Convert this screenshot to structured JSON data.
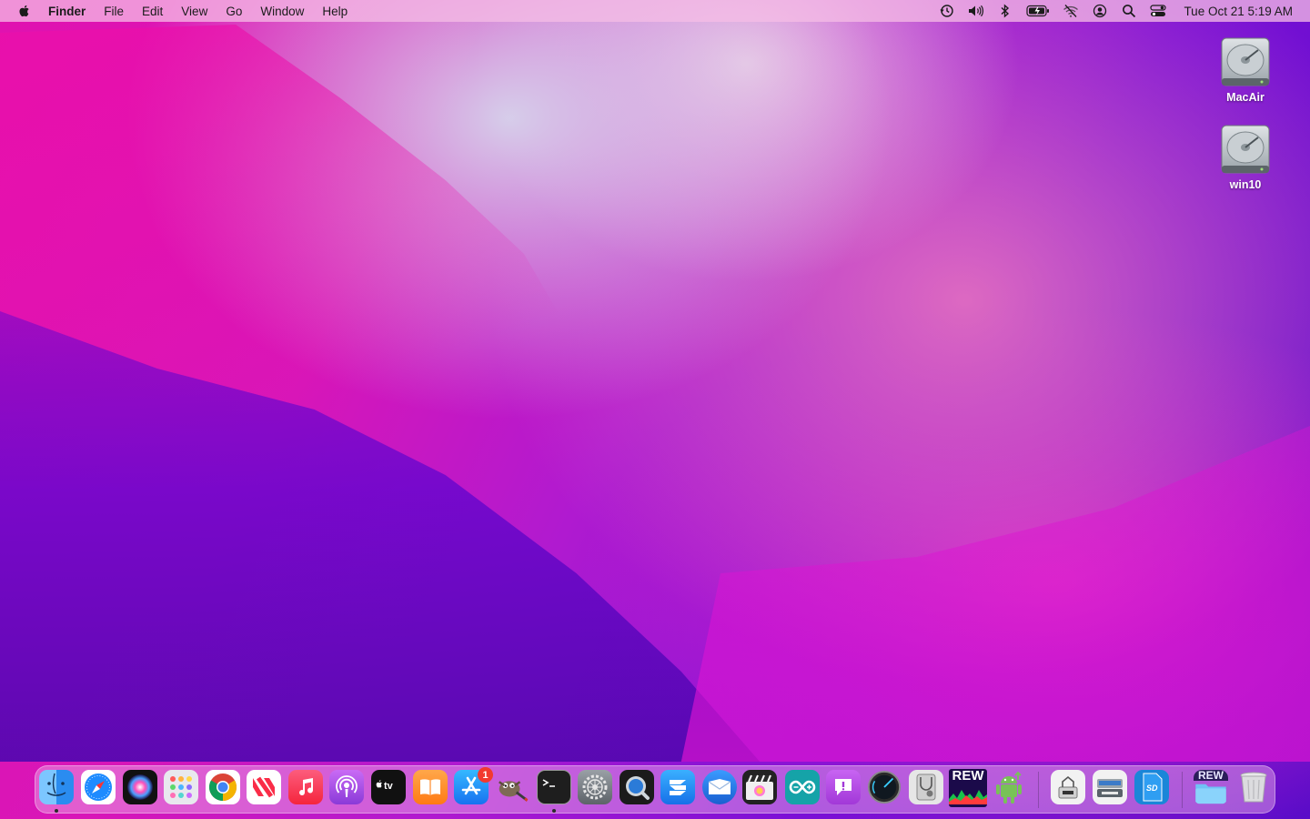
{
  "menubar": {
    "app_name": "Finder",
    "menus": [
      "File",
      "Edit",
      "View",
      "Go",
      "Window",
      "Help"
    ],
    "status_icons": [
      "time-machine",
      "volume",
      "bluetooth",
      "battery",
      "wifi-off",
      "user",
      "spotlight-search",
      "control-center"
    ],
    "clock": "Tue Oct 21  5:19 AM"
  },
  "desktop": {
    "drives": [
      {
        "label": "MacAir"
      },
      {
        "label": "win10"
      }
    ]
  },
  "dock": {
    "apps": [
      "Finder",
      "Safari",
      "Siri",
      "Launchpad",
      "Google Chrome",
      "News",
      "Music",
      "Podcasts",
      "TV",
      "Books",
      "App Store",
      "GIMP",
      "Terminal",
      "System Preferences",
      "QuickTime Player",
      "Stack app",
      "Mail app",
      "Final Cut Pro",
      "Arduino",
      "Feedback Assistant",
      "Disk speed app",
      "Disk Utility",
      "REW",
      "Android File Transfer",
      "Network utility",
      "Image utility",
      "SD Card Formatter",
      "Folder stack",
      "Trash"
    ],
    "app_store_badge": "1",
    "rew_label": "REW",
    "rew_folder_label": "REW",
    "sd_label": "SD",
    "colors": {
      "accent": "#1e8bff",
      "badge": "#f23a2f"
    }
  }
}
